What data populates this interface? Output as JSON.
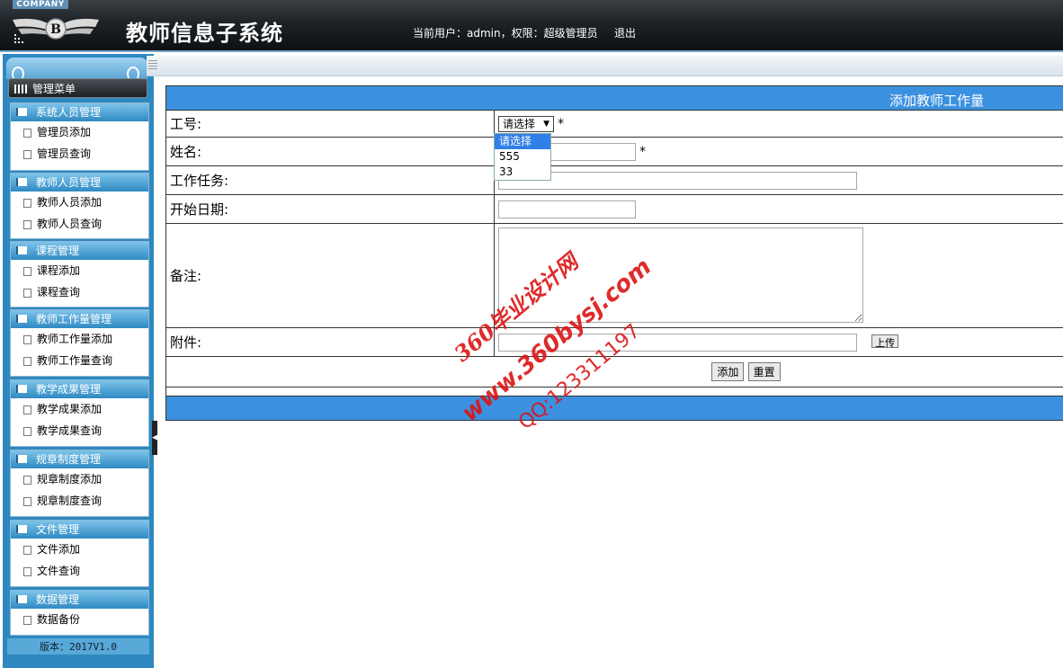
{
  "header": {
    "company": "COMPANY",
    "title": "教师信息子系统",
    "user_info": "当前用户：admin，权限：超级管理员",
    "logout": "退出"
  },
  "sidebar": {
    "menu_title": "管理菜单",
    "groups": [
      {
        "title": "系统人员管理",
        "items": [
          "管理员添加",
          "管理员查询"
        ]
      },
      {
        "title": "教师人员管理",
        "items": [
          "教师人员添加",
          "教师人员查询"
        ]
      },
      {
        "title": "课程管理",
        "items": [
          "课程添加",
          "课程查询"
        ]
      },
      {
        "title": "教师工作量管理",
        "items": [
          "教师工作量添加",
          "教师工作量查询"
        ]
      },
      {
        "title": "教学成果管理",
        "items": [
          "教学成果添加",
          "教学成果查询"
        ]
      },
      {
        "title": "规章制度管理",
        "items": [
          "规章制度添加",
          "规章制度查询"
        ]
      },
      {
        "title": "文件管理",
        "items": [
          "文件添加",
          "文件查询"
        ]
      },
      {
        "title": "数据管理",
        "items": [
          "数据备份"
        ]
      }
    ],
    "version": "版本：2017V1.0"
  },
  "form": {
    "title": "添加教师工作量",
    "fields": {
      "id_label": "工号:",
      "id_select_value": "请选择",
      "id_options": [
        "请选择",
        "555",
        "33"
      ],
      "name_label": "姓名:",
      "task_label": "工作任务:",
      "start_label": "开始日期:",
      "remark_label": "备注:",
      "attach_label": "附件:",
      "required_mark": "*"
    },
    "buttons": {
      "upload": "上传",
      "add": "添加",
      "reset": "重置"
    }
  },
  "watermark": {
    "line1": "360毕业设计网",
    "line2": "www.360bysj.com",
    "line3": "QQ:123311197"
  },
  "colors": {
    "accent": "#3b91e0",
    "sidebar": "#2e88bf",
    "header": "#1d2226",
    "watermark": "#dc1414"
  }
}
